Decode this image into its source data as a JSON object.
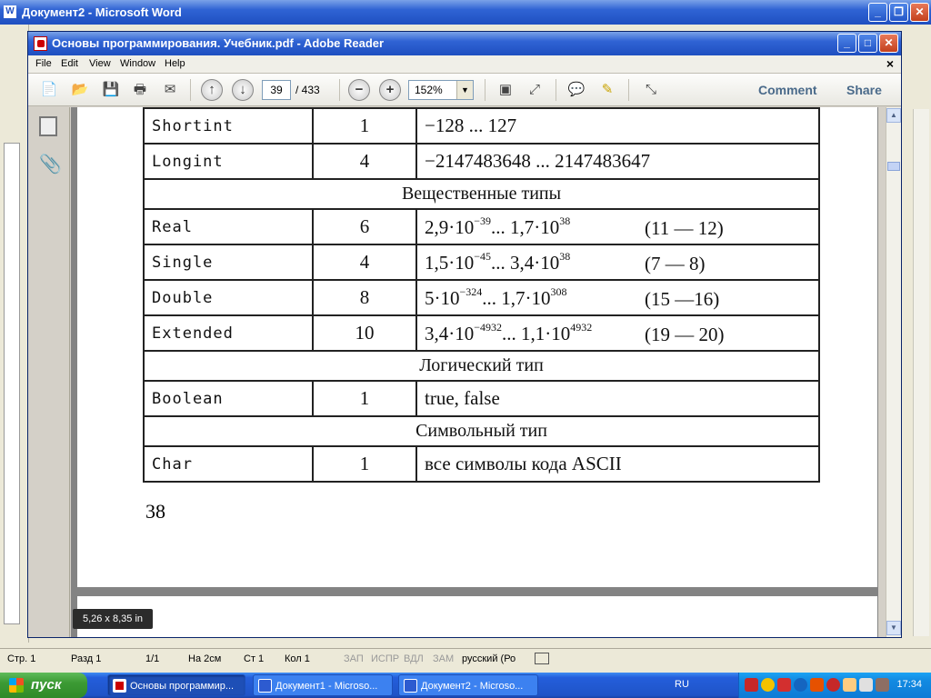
{
  "word": {
    "title": "Документ2 - Microsoft Word",
    "icon_letter": "W",
    "status": {
      "page": "Стр.  1",
      "section": "Разд  1",
      "pages": "1/1",
      "at": "На  2см",
      "line": "Ст  1",
      "col": "Кол  1",
      "rec": "ЗАП",
      "trk": "ИСПР",
      "ext": "ВДЛ",
      "ovr": "ЗАМ",
      "lang": "русский (Ро"
    }
  },
  "reader": {
    "title": "Основы программирования. Учебник.pdf - Adobe Reader",
    "menu": [
      "File",
      "Edit",
      "View",
      "Window",
      "Help"
    ],
    "menu_close": "×",
    "page_current": "39",
    "page_total": "/  433",
    "zoom": "152%",
    "comment_label": "Comment",
    "share_label": "Share",
    "size_tooltip": "5,26 x 8,35 in"
  },
  "pdf": {
    "rows_top": [
      {
        "type": "Shortint",
        "size": "1",
        "range": "−128 ... 127"
      },
      {
        "type": "Longint",
        "size": "4",
        "range": "−2147483648 ... 2147483647"
      }
    ],
    "section_real": "Вещественные типы",
    "rows_real": [
      {
        "type": "Real",
        "size": "6",
        "lo": "2,9·10",
        "lo_exp": "−39",
        "sep": "...  ",
        "hi": "1,7·10",
        "hi_exp": "38",
        "digits": "(11 — 12)"
      },
      {
        "type": "Single",
        "size": "4",
        "lo": "1,5·10",
        "lo_exp": "−45",
        "sep": "... ",
        "hi": "3,4·10",
        "hi_exp": "38",
        "digits": "(7 — 8)"
      },
      {
        "type": "Double",
        "size": "8",
        "lo": "5·10",
        "lo_exp": "−324",
        "sep": "... ",
        "hi": "1,7·10",
        "hi_exp": "308",
        "digits": "(15 —16)"
      },
      {
        "type": "Extended",
        "size": "10",
        "lo": "3,4·10",
        "lo_exp": "−4932",
        "sep": "... ",
        "hi": "1,1·10",
        "hi_exp": "4932",
        "digits": "(19 — 20)"
      }
    ],
    "section_bool": "Логический тип",
    "row_bool": {
      "type": "Boolean",
      "size": "1",
      "range": "true,  false"
    },
    "section_char": "Символьный тип",
    "row_char": {
      "type": "Char",
      "size": "1",
      "range": "все символы кода ASCII"
    },
    "page_number": "38"
  },
  "taskbar": {
    "start_label": "пуск",
    "tasks": [
      "Основы программир...",
      "Документ1 - Microso...",
      "Документ2 - Microso..."
    ],
    "lang": "RU",
    "clock": "17:34"
  }
}
